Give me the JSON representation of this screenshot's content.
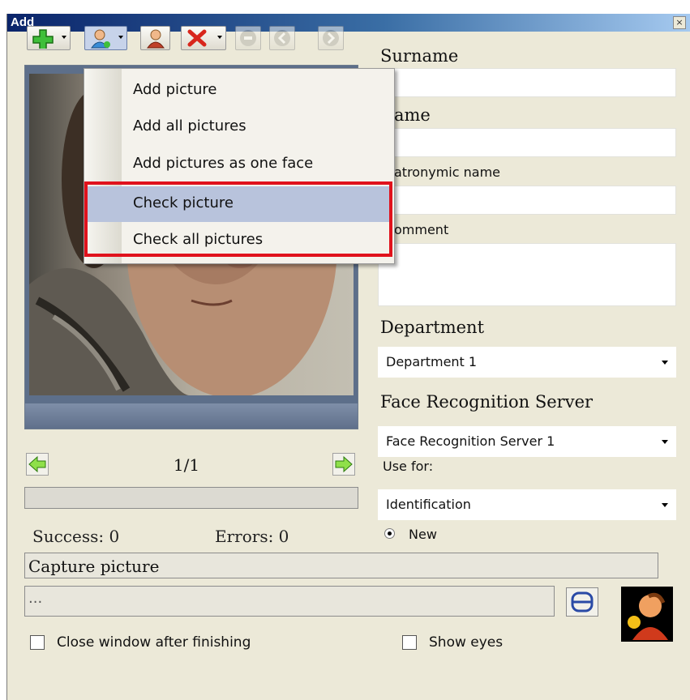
{
  "window": {
    "title": "Add",
    "close_symbol": "×"
  },
  "toolbar": {
    "buttons": [
      {
        "icon": "add-plus-icon",
        "dropdown": true,
        "enabled": true
      },
      {
        "icon": "person-icon",
        "dropdown": true,
        "enabled": true,
        "active": true
      },
      {
        "icon": "person-check-icon",
        "dropdown": false,
        "enabled": true
      },
      {
        "icon": "delete-x-icon",
        "dropdown": true,
        "enabled": true
      },
      {
        "icon": "stop-icon",
        "dropdown": false,
        "enabled": false
      },
      {
        "icon": "back-icon",
        "dropdown": false,
        "enabled": false
      },
      {
        "icon": "forward-icon",
        "dropdown": false,
        "enabled": false
      }
    ]
  },
  "menu": {
    "items": [
      {
        "label": "Add picture"
      },
      {
        "label": "Add all pictures"
      },
      {
        "label": "Add pictures as one face"
      },
      {
        "label": "Check picture",
        "highlighted": true
      },
      {
        "label": "Check all pictures"
      }
    ]
  },
  "photo": {
    "counter": "1/1"
  },
  "stats": {
    "success": "Success: 0",
    "errors": "Errors: 0"
  },
  "form": {
    "surname_label": "Surname",
    "surname_value": "",
    "name_label": "Name",
    "name_visible": "ame",
    "name_value": "",
    "patronymic_label": "Patronymic name",
    "patronymic_visible": "atronymic name",
    "patronymic_value": "",
    "comment_label": "Comment",
    "comment_visible": "omment",
    "comment_value": "",
    "department_label": "Department",
    "department_value": "Department 1",
    "server_label": "Face Recognition Server",
    "server_value": "Face Recognition Server 1",
    "use_for_label": "Use for:",
    "use_for_value": "Identification",
    "radio_label": "New"
  },
  "capture": {
    "label": "Capture picture",
    "path_placeholder": "..."
  },
  "options": {
    "close_window": "Close window after finishing",
    "show_eyes": "Show eyes"
  },
  "colors": {
    "highlight_border": "#e0121c",
    "menu_highlight": "#b8c3dc",
    "title_bar": "#0a246a"
  }
}
